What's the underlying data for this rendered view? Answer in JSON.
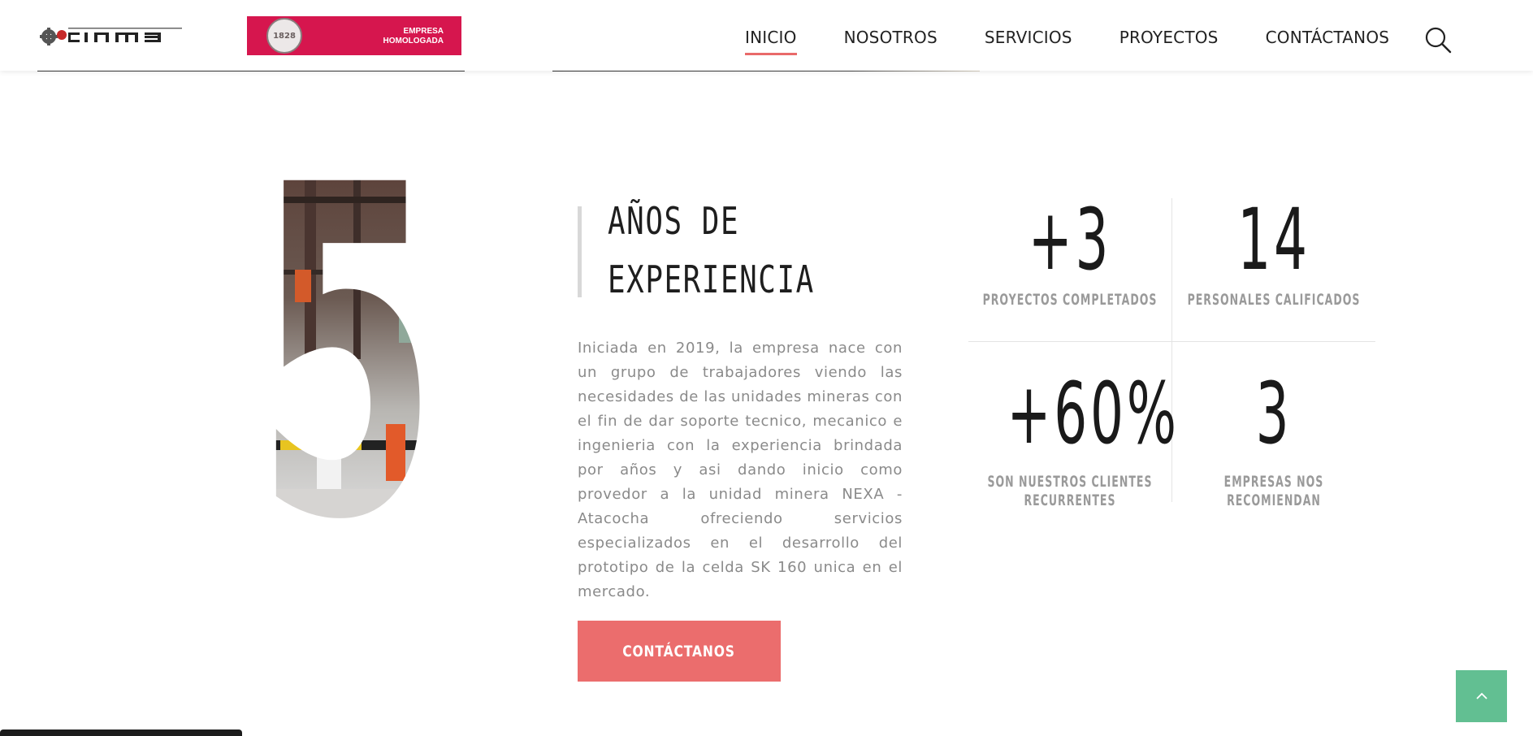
{
  "header": {
    "logo_cinma_alt": "cinma",
    "logo_bv_text_line1": "EMPRESA",
    "logo_bv_text_line2": "HOMOLOGADA",
    "logo_bv_seal": "1828",
    "nav": [
      "INICIO",
      "NOSOTROS",
      "SERVICIOS",
      "PROYECTOS",
      "CONTÁCTANOS"
    ],
    "active_nav": "INICIO",
    "search_icon": "search-icon"
  },
  "experience": {
    "big_number": "5",
    "title_line1": "AÑOS DE",
    "title_line2": "EXPERIENCIA",
    "description": "Iniciada en 2019, la empresa nace con un grupo de trabajadores viendo las necesidades de las unidades mineras con el fin de dar soporte tecnico, mecanico e ingenieria con la experiencia brindada por años y asi dando inicio como provedor a la unidad minera NEXA - Atacocha ofreciendo servicios especializados en el desarrollo del prototipo de la celda SK 160 unica en el mercado.",
    "cta_label": "CONTÁCTANOS"
  },
  "stats": [
    {
      "value": "+3",
      "label": "PROYECTOS COMPLETADOS"
    },
    {
      "value": "14",
      "label": "PERSONALES CALIFICADOS"
    },
    {
      "value": "+60%",
      "label": "SON NUESTROS CLIENTES RECURRENTES"
    },
    {
      "value": "3",
      "label": "EMPRESAS NOS RECOMIENDAN"
    }
  ],
  "colors": {
    "accent": "#eb6d6d",
    "back_to_top": "#62bf92",
    "logo_red": "#d6164e"
  },
  "back_to_top_icon": "chevron-up-icon"
}
